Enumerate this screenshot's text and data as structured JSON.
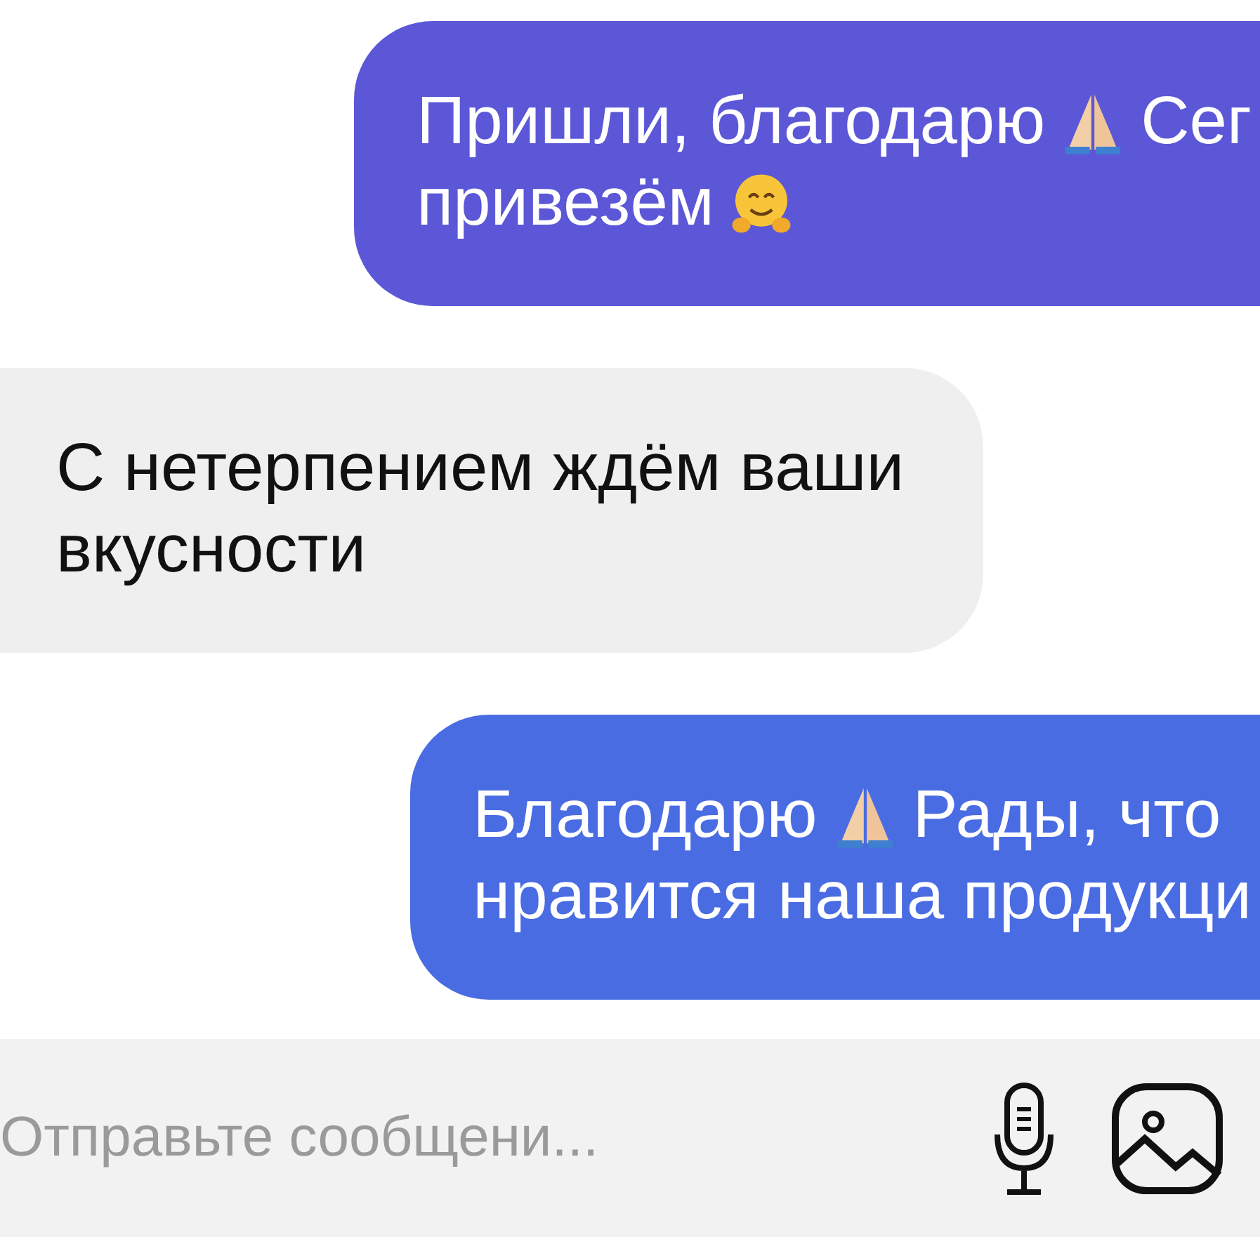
{
  "messages": [
    {
      "kind": "outgoing",
      "color": "#5b57d7",
      "lines": [
        [
          {
            "kind": "text",
            "text": "Пришли, благодарю"
          },
          {
            "kind": "pray"
          },
          {
            "kind": "text",
            "text": "Сег"
          }
        ],
        [
          {
            "kind": "text",
            "text": "привезём"
          },
          {
            "kind": "hug"
          }
        ]
      ]
    },
    {
      "kind": "incoming",
      "color": "#efefef",
      "lines": [
        [
          {
            "kind": "text",
            "text": "С нетерпением ждём ваши"
          }
        ],
        [
          {
            "kind": "text",
            "text": "вкусности"
          }
        ]
      ]
    },
    {
      "kind": "outgoing",
      "color": "#4a6ce3",
      "lines": [
        [
          {
            "kind": "text",
            "text": "Благодарю"
          },
          {
            "kind": "pray"
          },
          {
            "kind": "text",
            "text": "Рады, что"
          }
        ],
        [
          {
            "kind": "text",
            "text": "нравится наша продукци"
          }
        ]
      ]
    }
  ],
  "composer": {
    "placeholder": "Отправьте сообщени..."
  }
}
